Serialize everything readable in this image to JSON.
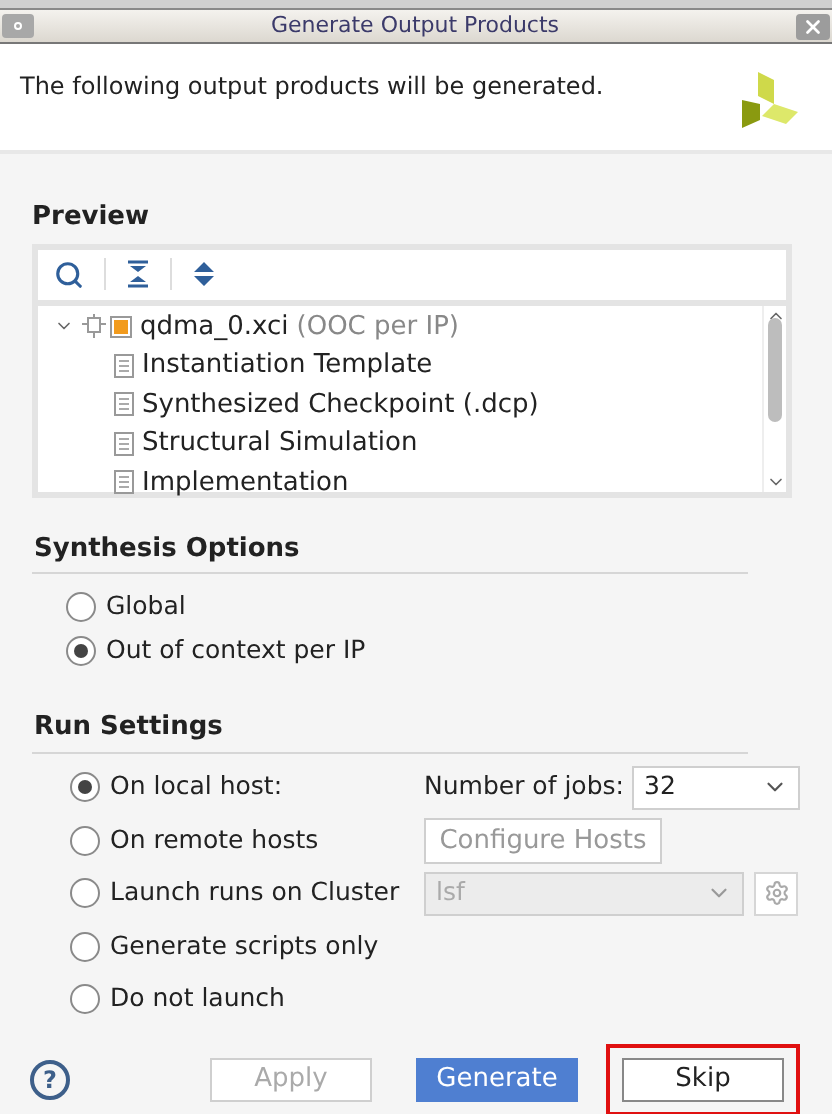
{
  "window": {
    "title": "Generate Output Products"
  },
  "header": {
    "message": "The following output products will be generated."
  },
  "preview": {
    "label": "Preview",
    "tree": [
      {
        "name": "qdma_0.xci",
        "note": "(OOC per IP)",
        "expanded": true,
        "children": [
          {
            "name": "Instantiation Template"
          },
          {
            "name": "Synthesized Checkpoint (.dcp)"
          },
          {
            "name": "Structural Simulation"
          },
          {
            "name": "Implementation"
          }
        ]
      }
    ]
  },
  "synthesis_options": {
    "label": "Synthesis Options",
    "options": [
      {
        "label": "Global",
        "selected": false
      },
      {
        "label": "Out of context per IP",
        "selected": true
      }
    ]
  },
  "run_settings": {
    "label": "Run Settings",
    "options": [
      {
        "label": "On local host:",
        "selected": true,
        "kind": "jobs",
        "jobs_label": "Number of jobs:",
        "jobs_value": "32"
      },
      {
        "label": "On remote hosts",
        "selected": false,
        "kind": "hosts",
        "button": "Configure Hosts"
      },
      {
        "label": "Launch runs on Cluster",
        "selected": false,
        "kind": "cluster",
        "value": "lsf",
        "disabled": true
      },
      {
        "label": "Generate scripts only",
        "selected": false,
        "kind": "plain"
      },
      {
        "label": "Do not launch",
        "selected": false,
        "kind": "plain"
      }
    ]
  },
  "help_button": "?",
  "buttons": [
    {
      "label": "Apply",
      "kind": "secondary",
      "disabled": true,
      "highlighted": false
    },
    {
      "label": "Generate",
      "kind": "primary",
      "disabled": false,
      "highlighted": false
    },
    {
      "label": "Skip",
      "kind": "secondary",
      "disabled": false,
      "highlighted": true
    }
  ]
}
